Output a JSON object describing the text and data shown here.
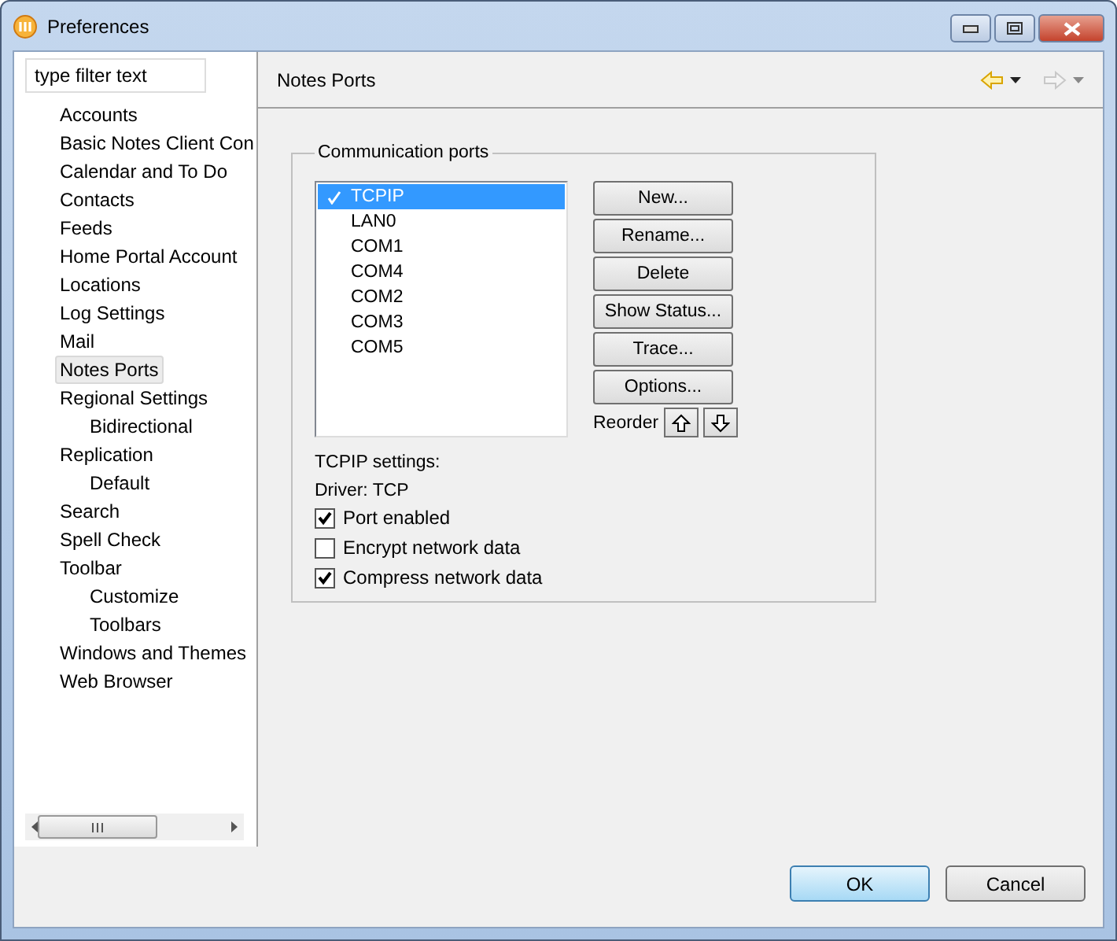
{
  "window": {
    "title": "Preferences"
  },
  "sidebar": {
    "filter": {
      "placeholder": "type filter text"
    },
    "items": [
      {
        "label": "Accounts",
        "selected": false
      },
      {
        "label": "Basic Notes Client Con",
        "selected": false
      },
      {
        "label": "Calendar and To Do",
        "selected": false
      },
      {
        "label": "Contacts",
        "selected": false
      },
      {
        "label": "Feeds",
        "selected": false
      },
      {
        "label": "Home Portal Account",
        "selected": false
      },
      {
        "label": "Locations",
        "selected": false
      },
      {
        "label": "Log Settings",
        "selected": false
      },
      {
        "label": "Mail",
        "selected": false
      },
      {
        "label": "Notes Ports",
        "selected": true
      },
      {
        "label": "Regional Settings",
        "selected": false,
        "children": [
          {
            "label": "Bidirectional",
            "selected": false
          }
        ]
      },
      {
        "label": "Replication",
        "selected": false,
        "children": [
          {
            "label": "Default",
            "selected": false
          }
        ]
      },
      {
        "label": "Search",
        "selected": false
      },
      {
        "label": "Spell Check",
        "selected": false
      },
      {
        "label": "Toolbar",
        "selected": false,
        "children": [
          {
            "label": "Customize",
            "selected": false
          },
          {
            "label": "Toolbars",
            "selected": false
          }
        ]
      },
      {
        "label": "Windows and Themes",
        "selected": false
      },
      {
        "label": "Web Browser",
        "selected": false
      }
    ]
  },
  "page": {
    "title": "Notes Ports",
    "back_enabled": true,
    "forward_enabled": false
  },
  "group": {
    "title": "Communication ports",
    "ports": [
      {
        "name": "TCPIP",
        "enabled": true,
        "selected": true
      },
      {
        "name": "LAN0",
        "enabled": false,
        "selected": false
      },
      {
        "name": "COM1",
        "enabled": false,
        "selected": false
      },
      {
        "name": "COM4",
        "enabled": false,
        "selected": false
      },
      {
        "name": "COM2",
        "enabled": false,
        "selected": false
      },
      {
        "name": "COM3",
        "enabled": false,
        "selected": false
      },
      {
        "name": "COM5",
        "enabled": false,
        "selected": false
      }
    ],
    "buttons": [
      "New...",
      "Rename...",
      "Delete",
      "Show Status...",
      "Trace...",
      "Options..."
    ],
    "reorder_label": "Reorder",
    "settings_title": "TCPIP settings:",
    "driver": "Driver: TCP",
    "options": [
      {
        "label": "Port enabled",
        "checked": true
      },
      {
        "label": "Encrypt network data",
        "checked": false
      },
      {
        "label": "Compress network data",
        "checked": true
      }
    ]
  },
  "footer": {
    "ok": "OK",
    "cancel": "Cancel"
  }
}
